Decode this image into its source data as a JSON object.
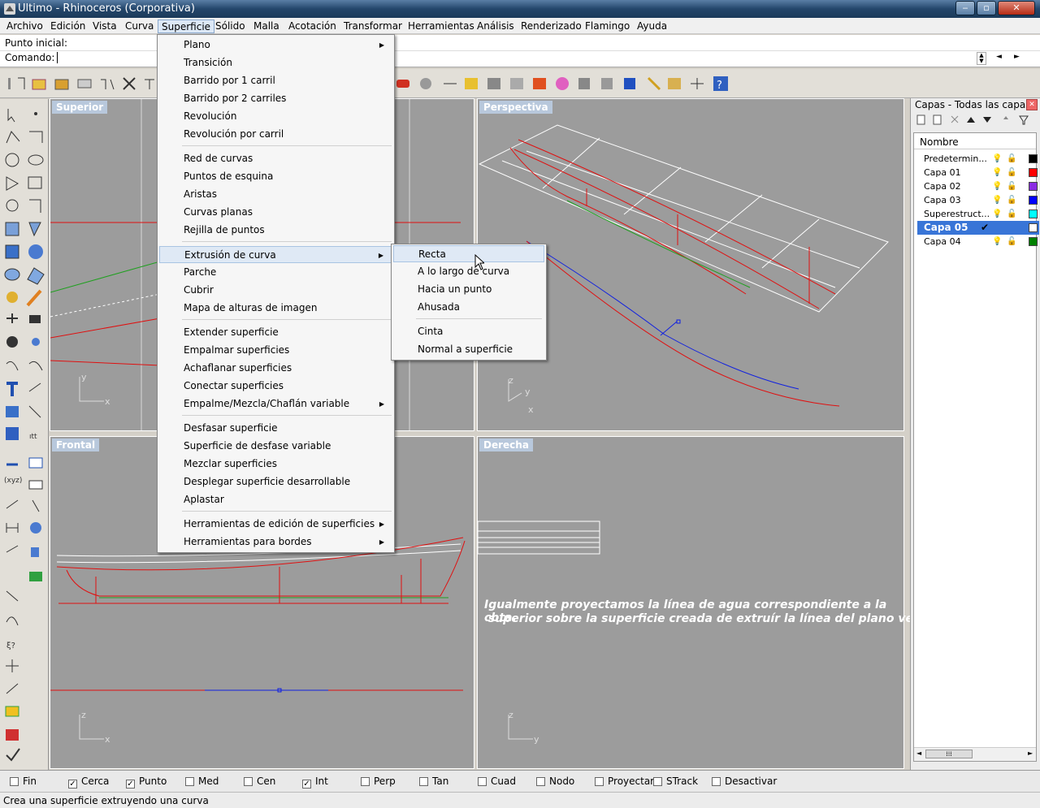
{
  "window": {
    "title": "Ultimo - Rhinoceros (Corporativa)",
    "min_label": "‒",
    "max_label": "▫",
    "close_label": "✕"
  },
  "menubar": [
    "Archivo",
    "Edición",
    "Vista",
    "Curva",
    "Superficie",
    "Sólido",
    "Malla",
    "Acotación",
    "Transformar",
    "Herramientas",
    "Análisis",
    "Renderizado",
    "Flamingo",
    "Ayuda"
  ],
  "command": {
    "prompt1": "Punto inicial:",
    "prompt2": "Comando:"
  },
  "viewports": {
    "top": "Superior",
    "persp": "Perspectiva",
    "front": "Frontal",
    "right": "Derecha"
  },
  "axes": {
    "top": [
      "y",
      "x"
    ],
    "persp": [
      "z",
      "y",
      "x"
    ],
    "front": [
      "z",
      "x"
    ],
    "right": [
      "z",
      "y"
    ]
  },
  "caption": {
    "line1": "Igualmente proyectamos la línea de agua correspondiente a la cbta.",
    "line2": " superior sobre la superficie creada de extruír la línea del plano vertical."
  },
  "surface_menu": {
    "items": [
      "Plano",
      "Transición",
      "Barrido por 1 carril",
      "Barrido por 2 carriles",
      "Revolución",
      "Revolución por carril",
      "Red de curvas",
      "Puntos de esquina",
      "Aristas",
      "Curvas planas",
      "Rejilla de puntos",
      "Extrusión de curva",
      "Parche",
      "Cubrir",
      "Mapa de alturas de imagen",
      "Extender superficie",
      "Empalmar superficies",
      "Achaflanar superficies",
      "Conectar superficies",
      "Empalme/Mezcla/Chaflán variable",
      "Desfasar superficie",
      "Superficie de desfase variable",
      "Mezclar superficies",
      "Desplegar superficie desarrollable",
      "Aplastar",
      "Herramientas de edición de superficies",
      "Herramientas para bordes"
    ],
    "highlighted": "Extrusión de curva"
  },
  "extrusion_submenu": {
    "items": [
      "Recta",
      "A lo largo de curva",
      "Hacia un punto",
      "Ahusada",
      "Cinta",
      "Normal a superficie"
    ],
    "highlighted": "Recta"
  },
  "layers": {
    "title": "Capas - Todas las capas",
    "column": "Nombre",
    "rows": [
      {
        "name": "Predetermin...",
        "color": "#000000"
      },
      {
        "name": "Capa 01",
        "color": "#ff0000"
      },
      {
        "name": "Capa 02",
        "color": "#8a2be2"
      },
      {
        "name": "Capa 03",
        "color": "#0000ff"
      },
      {
        "name": "Superestruct...",
        "color": "#00ffff"
      },
      {
        "name": "Capa 05",
        "color": "#ffffff"
      },
      {
        "name": "Capa 04",
        "color": "#008000"
      }
    ],
    "current": "Capa 05"
  },
  "snaps": [
    {
      "label": "Fin",
      "checked": false
    },
    {
      "label": "Cerca",
      "checked": true
    },
    {
      "label": "Punto",
      "checked": true
    },
    {
      "label": "Med",
      "checked": false
    },
    {
      "label": "Cen",
      "checked": false
    },
    {
      "label": "Int",
      "checked": true
    },
    {
      "label": "Perp",
      "checked": false
    },
    {
      "label": "Tan",
      "checked": false
    },
    {
      "label": "Cuad",
      "checked": false
    },
    {
      "label": "Nodo",
      "checked": false
    },
    {
      "label": "Proyectar",
      "checked": false
    },
    {
      "label": "STrack",
      "checked": false
    },
    {
      "label": "Desactivar",
      "checked": false
    }
  ],
  "status": "Crea una superficie extruyendo una curva",
  "colors": {
    "accent": "#dce8f6",
    "curve_red": "#e01010",
    "curve_green": "#20a020",
    "curve_blue": "#1020e0"
  }
}
